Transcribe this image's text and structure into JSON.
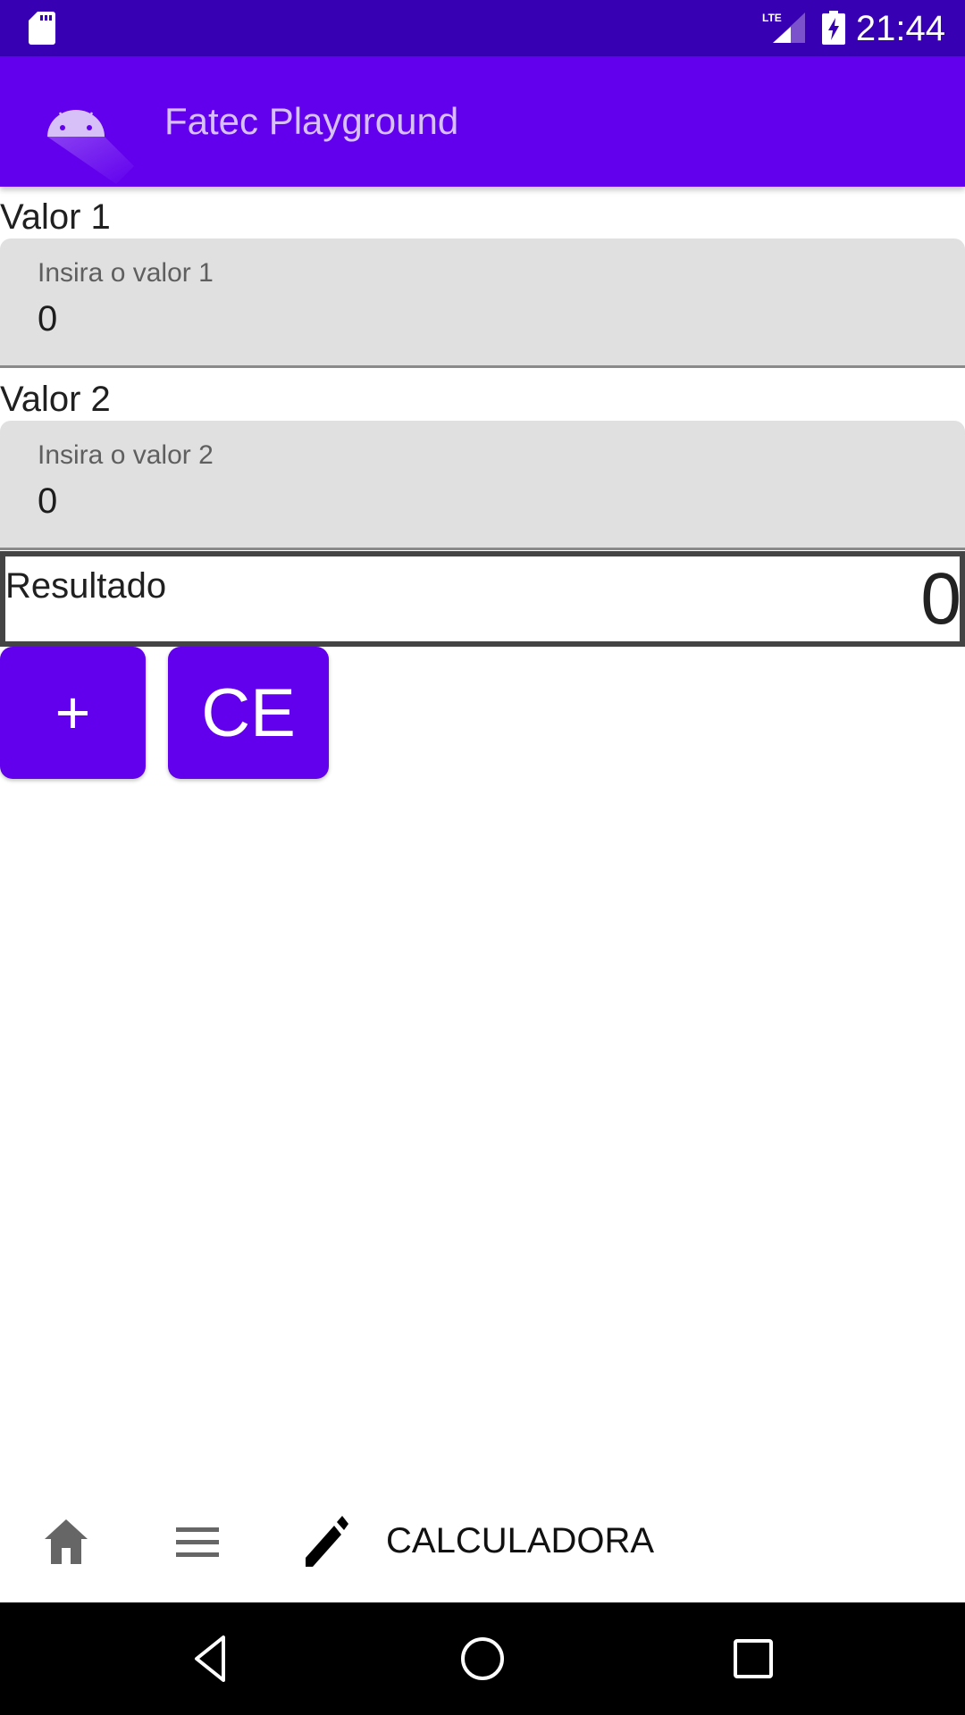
{
  "status_bar": {
    "time": "21:44",
    "icons": [
      "sd-card-icon",
      "lte-signal-icon",
      "battery-charging-icon"
    ],
    "network_label": "LTE"
  },
  "app_bar": {
    "title": "Fatec Playground",
    "logo_icon": "android-icon",
    "background_color": "#6200ee",
    "status_color": "#3700b3"
  },
  "form": {
    "valor1": {
      "label": "Valor 1",
      "hint": "Insira o valor 1",
      "value": "0"
    },
    "valor2": {
      "label": "Valor 2",
      "hint": "Insira o valor 2",
      "value": "0"
    },
    "resultado": {
      "label": "Resultado",
      "value": "0"
    }
  },
  "buttons": {
    "plus": "+",
    "clear": "CE"
  },
  "bottom_tabs": [
    {
      "icon": "home-icon",
      "label": ""
    },
    {
      "icon": "menu-icon",
      "label": ""
    },
    {
      "icon": "pencil-icon",
      "label": "CALCULADORA",
      "active": true
    }
  ],
  "nav_bar": {
    "buttons": [
      "back-icon",
      "home-circle-icon",
      "recents-icon"
    ]
  }
}
